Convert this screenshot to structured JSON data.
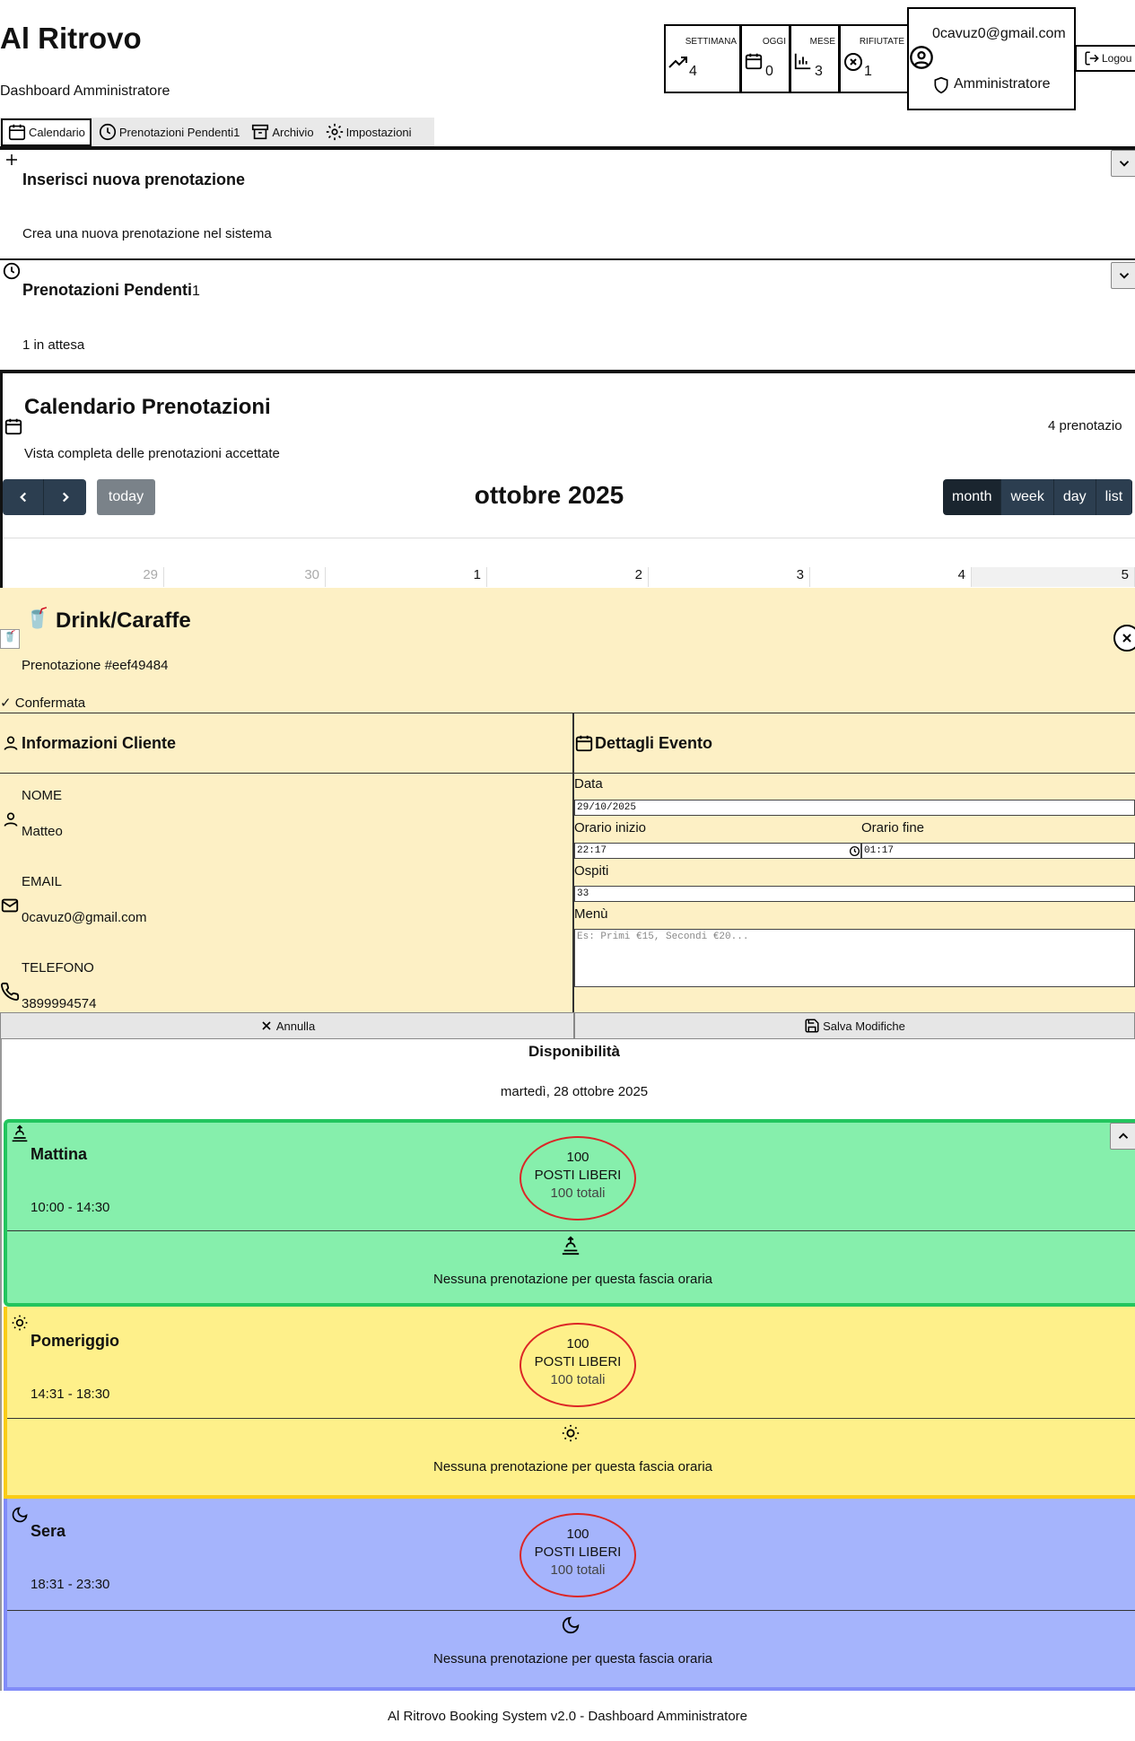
{
  "header": {
    "app_title": "Al Ritrovo",
    "subtitle": "Dashboard Amministratore"
  },
  "nav": [
    {
      "label": "Calendario",
      "icon": "calendar-icon",
      "active": true
    },
    {
      "label": "Prenotazioni Pendenti1",
      "icon": "clock-icon",
      "active": false
    },
    {
      "label": "Archivio",
      "icon": "archive-icon",
      "active": false
    },
    {
      "label": "Impostazioni",
      "icon": "gear-icon",
      "active": false
    }
  ],
  "stats": [
    {
      "label": "SETTIMANA",
      "value": "4",
      "icon": "trending-up-icon"
    },
    {
      "label": "OGGI",
      "value": "0",
      "icon": "calendar-icon"
    },
    {
      "label": "MESE",
      "value": "3",
      "icon": "bar-chart-icon"
    },
    {
      "label": "RIFIUTATE",
      "value": "1",
      "icon": "x-circle-icon"
    }
  ],
  "user": {
    "email": "0cavuz0@gmail.com",
    "role": "Amministratore",
    "logout_label": "Logou"
  },
  "new_booking": {
    "title": "Inserisci nuova prenotazione",
    "subtitle": "Crea una nuova prenotazione nel sistema"
  },
  "pending": {
    "title": "Prenotazioni Pendenti",
    "count": "1",
    "subtitle": "1 in attesa"
  },
  "calendar": {
    "title": "Calendario Prenotazioni",
    "subtitle": "Vista completa delle prenotazioni accettate",
    "count_label": "4 prenotazio",
    "month_title": "ottobre 2025",
    "today_label": "today",
    "views": [
      "month",
      "week",
      "day",
      "list"
    ],
    "day_numbers": [
      "29",
      "30",
      "1",
      "2",
      "3",
      "4",
      "5"
    ]
  },
  "modal": {
    "emoji": "🥤",
    "title": "Drink/Caraffe",
    "booking_id": "Prenotazione #eef49484",
    "status": "✓ Confermata",
    "client_header": "Informazioni Cliente",
    "event_header": "Dettagli Evento",
    "client": {
      "name_label": "NOME",
      "name": "Matteo",
      "email_label": "EMAIL",
      "email": "0cavuz0@gmail.com",
      "phone_label": "TELEFONO",
      "phone": "3899994574"
    },
    "event": {
      "date_label": "Data",
      "date": "29/10/2025",
      "start_label": "Orario inizio",
      "start": "22:17",
      "end_label": "Orario fine",
      "end": "01:17",
      "guests_label": "Ospiti",
      "guests": "33",
      "menu_label": "Menù",
      "menu_placeholder": "Es: Primi €15, Secondi €20..."
    },
    "cancel_label": "Annulla",
    "save_label": "Salva Modifiche"
  },
  "availability": {
    "title": "Disponibilità",
    "date": "martedì, 28 ottobre 2025",
    "slots": [
      {
        "name": "Mattina",
        "time": "10:00 - 14:30",
        "free": "100",
        "free_label": "POSTI LIBERI",
        "total": "100 totali",
        "empty": "Nessuna prenotazione per questa fascia oraria",
        "color": "#86efac",
        "border": "#22c55e"
      },
      {
        "name": "Pomeriggio",
        "time": "14:31 - 18:30",
        "free": "100",
        "free_label": "POSTI LIBERI",
        "total": "100 totali",
        "empty": "Nessuna prenotazione per questa fascia oraria",
        "color": "#fef08a",
        "border": "#facc15"
      },
      {
        "name": "Sera",
        "time": "18:31 - 23:30",
        "free": "100",
        "free_label": "POSTI LIBERI",
        "total": "100 totali",
        "empty": "Nessuna prenotazione per questa fascia oraria",
        "color": "#a5b4fc",
        "border": "#818cf8"
      }
    ]
  },
  "footer": "Al Ritrovo Booking System v2.0 - Dashboard Amministratore"
}
